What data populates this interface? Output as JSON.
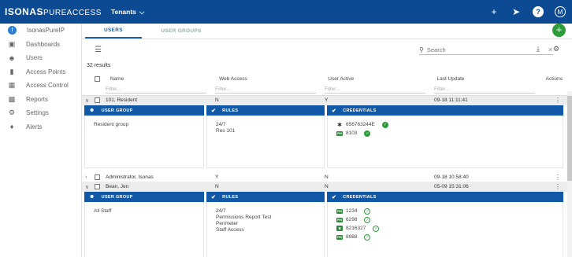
{
  "header": {
    "logo_main": "ISONAS",
    "logo_sub": "PUREACCESS",
    "tenants_label": "Tenants",
    "avatar_initial": "M"
  },
  "sidebar": {
    "items": [
      {
        "label": "IsonasPureIP",
        "icon": "info-icon"
      },
      {
        "label": "Dashboards",
        "icon": "dashboard-icon"
      },
      {
        "label": "Users",
        "icon": "users-icon"
      },
      {
        "label": "Access Points",
        "icon": "door-icon"
      },
      {
        "label": "Access Control",
        "icon": "calendar-icon"
      },
      {
        "label": "Reports",
        "icon": "report-icon"
      },
      {
        "label": "Settings",
        "icon": "gear-icon"
      },
      {
        "label": "Alerts",
        "icon": "bell-icon"
      }
    ]
  },
  "tabs": [
    {
      "label": "USERS"
    },
    {
      "label": "USER GROUPS"
    }
  ],
  "search": {
    "placeholder": "Search"
  },
  "results_label": "32 results",
  "columns": {
    "name": "Name",
    "web_access": "Web Access",
    "user_active": "User Active",
    "last_update": "Last Update",
    "actions": "Actions",
    "filter_placeholder": "Filter..."
  },
  "panel_titles": {
    "user_group": "USER GROUP",
    "rules": "RULES",
    "credentials": "CREDENTIALS"
  },
  "rows": [
    {
      "name": "101, Resident",
      "web": "N",
      "active": "Y",
      "updated": "09-18 11:11:41",
      "group": "Resident group",
      "rules": [
        "24/7",
        "Res 101"
      ],
      "credentials": [
        {
          "type": "bluetooth",
          "value": "656763244E"
        },
        {
          "type": "badge",
          "value": "8103"
        }
      ]
    },
    {
      "name": "Administrator, Isonas",
      "web": "Y",
      "active": "N",
      "updated": "09-18 10:58:40"
    },
    {
      "name": "Bean, Jen",
      "web": "N",
      "active": "N",
      "updated": "05-09 15:31:06",
      "group": "All Staff",
      "rules": [
        "24/7",
        "Permissions Report Test",
        "Perimeter",
        "Staff Access"
      ],
      "credentials": [
        {
          "type": "badge",
          "value": "1234"
        },
        {
          "type": "badge",
          "value": "6298"
        },
        {
          "type": "card",
          "value": "8216327"
        },
        {
          "type": "badge",
          "value": "8988"
        }
      ]
    }
  ],
  "colors": {
    "topbar": "#0c4a93",
    "panel_header": "#1158a6",
    "accent_green": "#2e9b3a",
    "tab_active": "#1a5fa8"
  }
}
